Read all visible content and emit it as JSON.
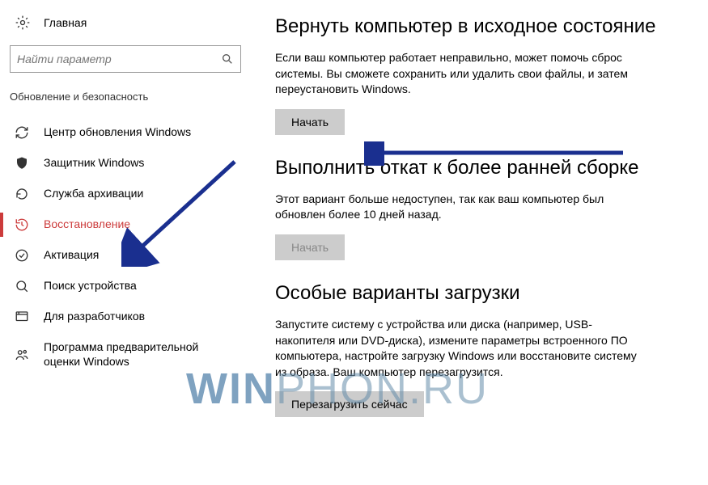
{
  "sidebar": {
    "home_label": "Главная",
    "search_placeholder": "Найти параметр",
    "category_label": "Обновление и безопасность",
    "items": [
      {
        "label": "Центр обновления Windows"
      },
      {
        "label": "Защитник Windows"
      },
      {
        "label": "Служба архивации"
      },
      {
        "label": "Восстановление"
      },
      {
        "label": "Активация"
      },
      {
        "label": "Поиск устройства"
      },
      {
        "label": "Для разработчиков"
      },
      {
        "label": "Программа предварительной оценки Windows"
      }
    ]
  },
  "main": {
    "reset": {
      "title": "Вернуть компьютер в исходное состояние",
      "desc": "Если ваш компьютер работает неправильно, может помочь сброс системы. Вы сможете сохранить или удалить свои файлы, и затем переустановить Windows.",
      "button": "Начать"
    },
    "rollback": {
      "title": "Выполнить откат к более ранней сборке",
      "desc": "Этот вариант больше недоступен, так как ваш компьютер был обновлен более 10 дней назад.",
      "button": "Начать"
    },
    "advanced": {
      "title": "Особые варианты загрузки",
      "desc": "Запустите систему с устройства или диска (например, USB-накопителя или DVD-диска), измените параметры встроенного ПО компьютера, настройте загрузку Windows или восстановите систему из образа. Ваш компьютер перезагрузится.",
      "button": "Перезагрузить сейчас"
    }
  },
  "watermark": {
    "a": "WIN",
    "b": "PHON.RU"
  }
}
